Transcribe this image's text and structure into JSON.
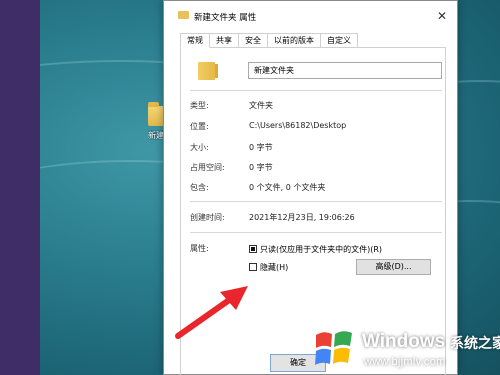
{
  "desktop": {
    "icon_label": "新建文"
  },
  "dialog": {
    "title": "新建文件夹 属性",
    "close_glyph": "✕",
    "tabs": [
      {
        "label": "常规",
        "active": true
      },
      {
        "label": "共享"
      },
      {
        "label": "安全"
      },
      {
        "label": "以前的版本"
      },
      {
        "label": "自定义"
      }
    ],
    "folder_name": "新建文件夹",
    "rows": {
      "type": {
        "label": "类型:",
        "value": "文件夹"
      },
      "location": {
        "label": "位置:",
        "value": "C:\\Users\\86182\\Desktop"
      },
      "size": {
        "label": "大小:",
        "value": "0 字节"
      },
      "size_on_disk": {
        "label": "占用空间:",
        "value": "0 字节"
      },
      "contains": {
        "label": "包含:",
        "value": "0 个文件, 0 个文件夹"
      },
      "created": {
        "label": "创建时间:",
        "value": "2021年12月23日, 19:06:26"
      }
    },
    "attributes": {
      "label": "属性:",
      "readonly": "只读(仅应用于文件夹中的文件)(R)",
      "hidden": "隐藏(H)",
      "advanced_button": "高级(D)...",
      "readonly_state": "indeterminate",
      "hidden_checked": false
    },
    "ok_button": "确定"
  },
  "watermark": {
    "brand": "Windows",
    "cn_text": "系统之家",
    "url": "www.bjjmlv.com"
  },
  "colors": {
    "arrow": "#e8262b",
    "desktop_teal": "#2b7f8f",
    "side_strip": "#3f2d67"
  }
}
